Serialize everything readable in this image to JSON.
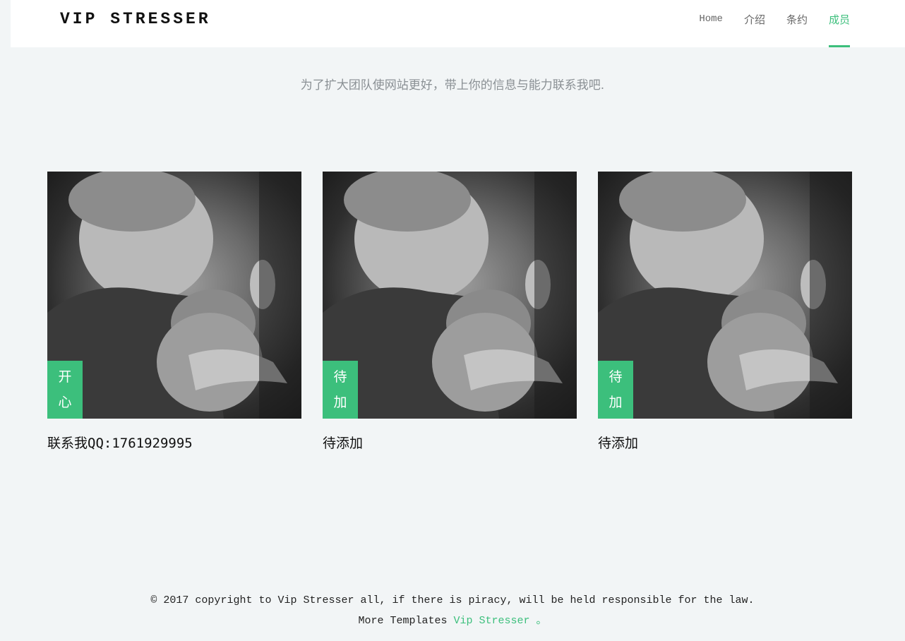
{
  "header": {
    "brand": "VIP STRESSER",
    "nav": [
      {
        "label": "Home"
      },
      {
        "label": "介绍"
      },
      {
        "label": "条约"
      },
      {
        "label": "成员"
      }
    ]
  },
  "intro": "为了扩大团队使网站更好，带上你的信息与能力联系我吧.",
  "members": [
    {
      "tag_top": "开",
      "tag_bottom": "心",
      "caption": "联系我QQ:1761929995",
      "image": "boy-hugging-kitten-photo"
    },
    {
      "tag_top": "待",
      "tag_bottom": "加",
      "caption": "待添加",
      "image": "boy-hugging-kitten-photo"
    },
    {
      "tag_top": "待",
      "tag_bottom": "加",
      "caption": "待添加",
      "image": "boy-hugging-kitten-photo"
    }
  ],
  "footer": {
    "copyright": "© 2017 copyright to Vip Stresser all, if there is piracy, will be held responsible for the law.",
    "more_prefix": "More Templates",
    "more_link": "Vip Stresser",
    "more_suffix": "。"
  },
  "colors": {
    "accent": "#3cbf7c",
    "background": "#f2f5f6",
    "header": "#ffffff"
  }
}
